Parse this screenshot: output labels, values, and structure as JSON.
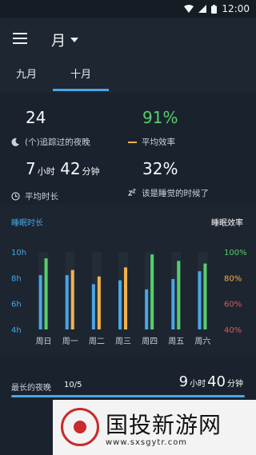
{
  "status_bar": {
    "time": "12:00",
    "icons": [
      "wifi-icon",
      "signal-icon",
      "battery-icon"
    ]
  },
  "toolbar": {
    "menu_icon": "menu-icon",
    "period_label": "月"
  },
  "tabs": [
    {
      "label": "九月",
      "active": false
    },
    {
      "label": "十月",
      "active": true
    }
  ],
  "stats": {
    "nights": {
      "value": "24",
      "label": "(个)追踪过的夜晚",
      "icon": "moon-icon"
    },
    "efficiency": {
      "value": "91%",
      "label": "平均效率",
      "icon": "efficiency-line-icon"
    },
    "avg_time": {
      "hours": "7",
      "hour_unit": "小时",
      "minutes": "42",
      "minute_unit": "分钟",
      "label": "平均时长",
      "icon": "clock-icon"
    },
    "bedtime": {
      "value": "32%",
      "label": "该是睡觉的时候了",
      "icon": "zzz-icon"
    }
  },
  "chart_section": {
    "left_title": "睡眠时长",
    "right_title": "睡眠效率",
    "colors": {
      "blue": "#4aa6e6",
      "green": "#57d06b",
      "orange": "#f2b24c",
      "red": "#e0585a"
    }
  },
  "chart_data": {
    "type": "bar",
    "categories": [
      "周日",
      "周一",
      "周二",
      "周三",
      "周四",
      "周五",
      "周六"
    ],
    "series": [
      {
        "name": "睡眠时长",
        "values": [
          8.2,
          8.2,
          7.5,
          7.8,
          7.1,
          7.9,
          8.5
        ]
      },
      {
        "name": "睡眠效率",
        "values": [
          95,
          86,
          81,
          88,
          98,
          93,
          91
        ]
      }
    ],
    "y_left": {
      "ticks": [
        "10h",
        "8h",
        "6h",
        "4h"
      ],
      "range": [
        4,
        10
      ]
    },
    "y_right": {
      "ticks": [
        "100%",
        "80%",
        "60%",
        "40%"
      ],
      "range": [
        40,
        100
      ],
      "tick_colors": [
        "#57d06b",
        "#f2b24c",
        "#e0585a",
        "#e0585a"
      ]
    }
  },
  "longest": {
    "label": "最长的夜晚",
    "date": "10/5",
    "hours": "9",
    "hour_unit": "小时",
    "minutes": "40",
    "minute_unit": "分钟"
  },
  "badge": {
    "title": "国投新游网",
    "site": "www.sxsgytr.com"
  }
}
